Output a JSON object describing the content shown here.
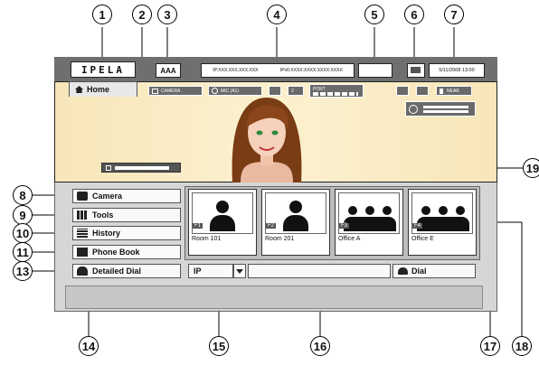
{
  "callouts": [
    "1",
    "2",
    "3",
    "4",
    "5",
    "6",
    "7",
    "8",
    "9",
    "10",
    "11",
    "13",
    "14",
    "15",
    "16",
    "17",
    "18",
    "19"
  ],
  "logo": "IPELA",
  "site_name": "AAA",
  "ip_address": "IP:XXX.XXX.XXX.XXX",
  "ipv6_address": "IPv6:XXXX:XXXX:XXXX:XXXX",
  "datetime": "5/11/2008 13:00",
  "home_tab": "Home",
  "video_bar": {
    "camera": "CAMERA",
    "mic": "MIC (A1)",
    "port": "PORT",
    "net_count": "2",
    "near": "NEAR"
  },
  "menu": {
    "camera": "Camera",
    "tools": "Tools",
    "history": "History",
    "phone_book": "Phone Book",
    "detailed_dial": "Detailed Dial"
  },
  "speed_dials": [
    {
      "key": "F1",
      "label": "Room 101"
    },
    {
      "key": "F2",
      "label": "Room 201"
    },
    {
      "key": "F3",
      "label": "Office A"
    },
    {
      "key": "F4",
      "label": "Office E"
    }
  ],
  "dial": {
    "mode": "IP",
    "number_value": "",
    "dial_label": "Dial"
  },
  "colors": {
    "video_bg": "#fbefcc",
    "frame": "#d6d6d6",
    "topbar": "#6f6f6f"
  }
}
